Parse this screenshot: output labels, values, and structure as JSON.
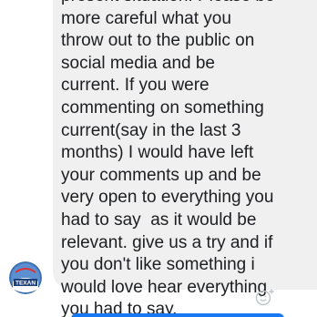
{
  "message": {
    "text": "present situation. Please be\nmore careful what you\nthrow out to the public on\nsocial media and be\ncurrent. If you were\ncommenting on something\ncurrent(say in the last 3\nmonths) I would have left\nyour comments up and be\nvery open to everything you\nhad to say  as it would be\nrelevant. give us a try and if\nyou don't like something i\nwould love hear everything\nyou had to say."
  },
  "avatar": {
    "logo_text": "TEXAN"
  },
  "icons": {
    "react": "emoji-add-icon",
    "avatar": "texan-logo-icon"
  },
  "colors": {
    "bubble": "#f1f0f0",
    "text": "#1c1e21",
    "accent": "#1877f2"
  }
}
